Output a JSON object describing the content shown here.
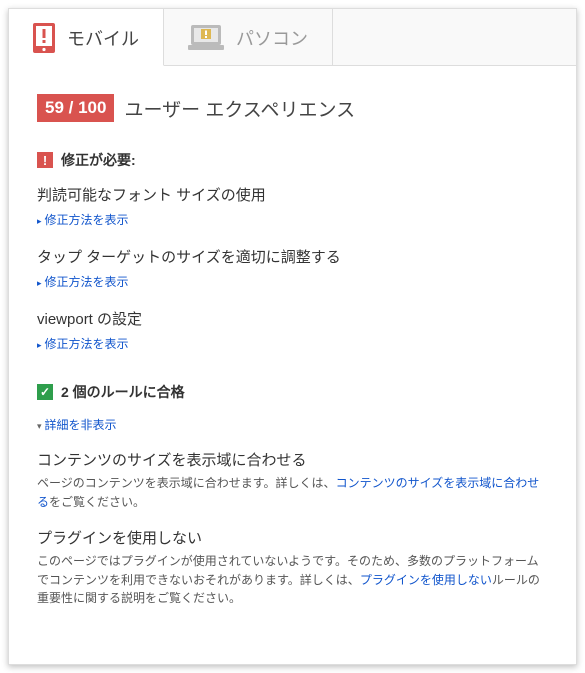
{
  "tabs": {
    "mobile": "モバイル",
    "desktop": "パソコン"
  },
  "score": {
    "badge": "59 / 100",
    "title": "ユーザー エクスペリエンス"
  },
  "fix_section": {
    "header": "修正が必要:",
    "rules": [
      {
        "title": "判読可能なフォント サイズの使用",
        "show_fix": "修正方法を表示"
      },
      {
        "title": "タップ ターゲットのサイズを適切に調整する",
        "show_fix": "修正方法を表示"
      },
      {
        "title": "viewport の設定",
        "show_fix": "修正方法を表示"
      }
    ]
  },
  "passed_section": {
    "header": "2 個のルールに合格",
    "hide_details": "詳細を非表示",
    "rules": [
      {
        "title": "コンテンツのサイズを表示域に合わせる",
        "desc_pre": "ページのコンテンツを表示域に合わせます。詳しくは、",
        "link": "コンテンツのサイズを表示域に合わせる",
        "desc_post": "をご覧ください。"
      },
      {
        "title": "プラグインを使用しない",
        "desc_pre": "このページではプラグインが使用されていないようです。そのため、多数のプラットフォームでコンテンツを利用できないおそれがあります。詳しくは、",
        "link": "プラグインを使用しない",
        "desc_post": "ルールの重要性に関する説明をご覧ください。"
      }
    ]
  }
}
